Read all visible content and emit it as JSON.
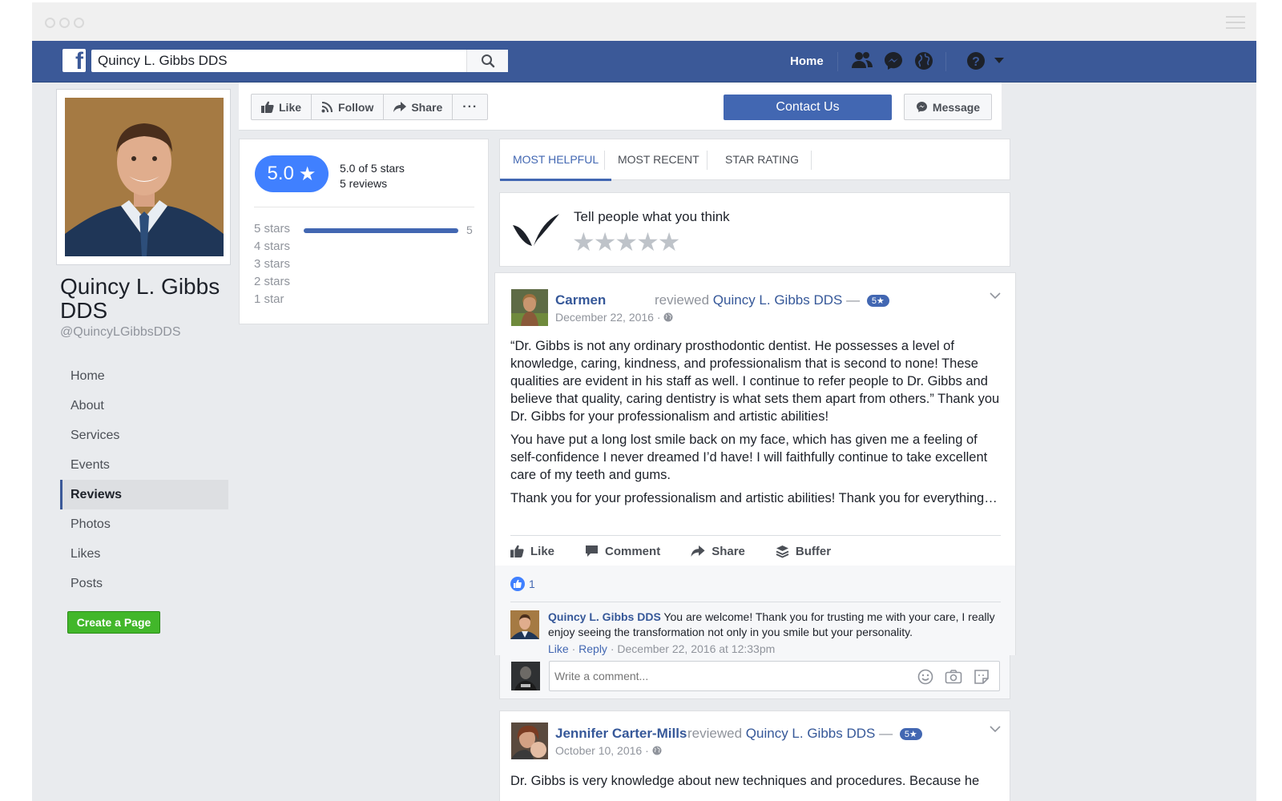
{
  "colors": {
    "fb_blue": "#3b5998",
    "accent": "#4267b2",
    "rating_pill": "#4080ff",
    "green": "#42b72a"
  },
  "topbar": {
    "search_value": "Quincy L. Gibbs DDS",
    "nav_home": "Home",
    "icons": [
      "facebook-logo-icon",
      "search-icon",
      "friends-icon",
      "messenger-icon",
      "globe-icon",
      "help-icon",
      "caret-down-icon"
    ]
  },
  "profile": {
    "name": "Quincy L. Gibbs DDS",
    "handle": "@QuincyLGibbsDDS"
  },
  "left_nav": {
    "items": [
      {
        "label": "Home",
        "active": false
      },
      {
        "label": "About",
        "active": false
      },
      {
        "label": "Services",
        "active": false
      },
      {
        "label": "Events",
        "active": false
      },
      {
        "label": "Reviews",
        "active": true
      },
      {
        "label": "Photos",
        "active": false
      },
      {
        "label": "Likes",
        "active": false
      },
      {
        "label": "Posts",
        "active": false
      }
    ],
    "create_page": "Create a Page"
  },
  "action_bar": {
    "like": "Like",
    "follow": "Follow",
    "share": "Share",
    "more": "···",
    "contact": "Contact Us",
    "message": "Message"
  },
  "rating": {
    "score": "5.0",
    "star": "★",
    "summary": "5.0 of 5 stars",
    "count": "5 reviews",
    "rows": [
      {
        "label": "5 stars",
        "count": "5"
      },
      {
        "label": "4 stars",
        "count": ""
      },
      {
        "label": "3 stars",
        "count": ""
      },
      {
        "label": "2 stars",
        "count": ""
      },
      {
        "label": "1 star",
        "count": ""
      }
    ]
  },
  "tabs": [
    {
      "label": "MOST HELPFUL",
      "active": true
    },
    {
      "label": "MOST RECENT",
      "active": false
    },
    {
      "label": "STAR RATING",
      "active": false
    }
  ],
  "tell": {
    "prompt": "Tell people what you think",
    "stars": "★★★★★"
  },
  "review1": {
    "author": "Carmen",
    "reviewed": "reviewed",
    "target": "Quincy L. Gibbs DDS",
    "dash": "—",
    "badge": "5★",
    "date": "December 22, 2016 ·",
    "paragraphs": [
      "“Dr. Gibbs is not any ordinary prosthodontic dentist. He possesses a level of knowledge, caring, kindness, and professionalism that is second to none! These qualities are evident in his staff as well. I continue to refer people to Dr. Gibbs and believe that quality, caring dentistry is what sets them apart from others.” Thank you Dr. Gibbs for your professionalism and artistic abilities!",
      "You have put a long lost smile back on my face, which has given me a feeling of self-confidence I never dreamed I’d have! I will faithfully continue to take excellent care of my teeth and gums.",
      "Thank you for your professionalism and artistic abilities! Thank you for everything…"
    ],
    "actions": {
      "like": "Like",
      "comment": "Comment",
      "share": "Share",
      "buffer": "Buffer"
    },
    "like_count": "1",
    "reply": {
      "author": "Quincy L. Gibbs DDS",
      "text": " You are welcome! Thank you for trusting me with your care, I really enjoy seeing the transformation not only in you smile but your personality.",
      "like": "Like",
      "sep1": " · ",
      "reply": "Reply",
      "sep2": " · ",
      "time": "December 22, 2016 at 12:33pm"
    }
  },
  "comment_box": {
    "placeholder": "Write a comment..."
  },
  "review2": {
    "author": "Jennifer Carter-Mills",
    "reviewed": "reviewed",
    "target": "Quincy L. Gibbs DDS",
    "dash": "—",
    "badge": "5★",
    "date": "October 10, 2016 ·",
    "text": "Dr. Gibbs is very knowledge about new techniques and procedures. Because he"
  }
}
